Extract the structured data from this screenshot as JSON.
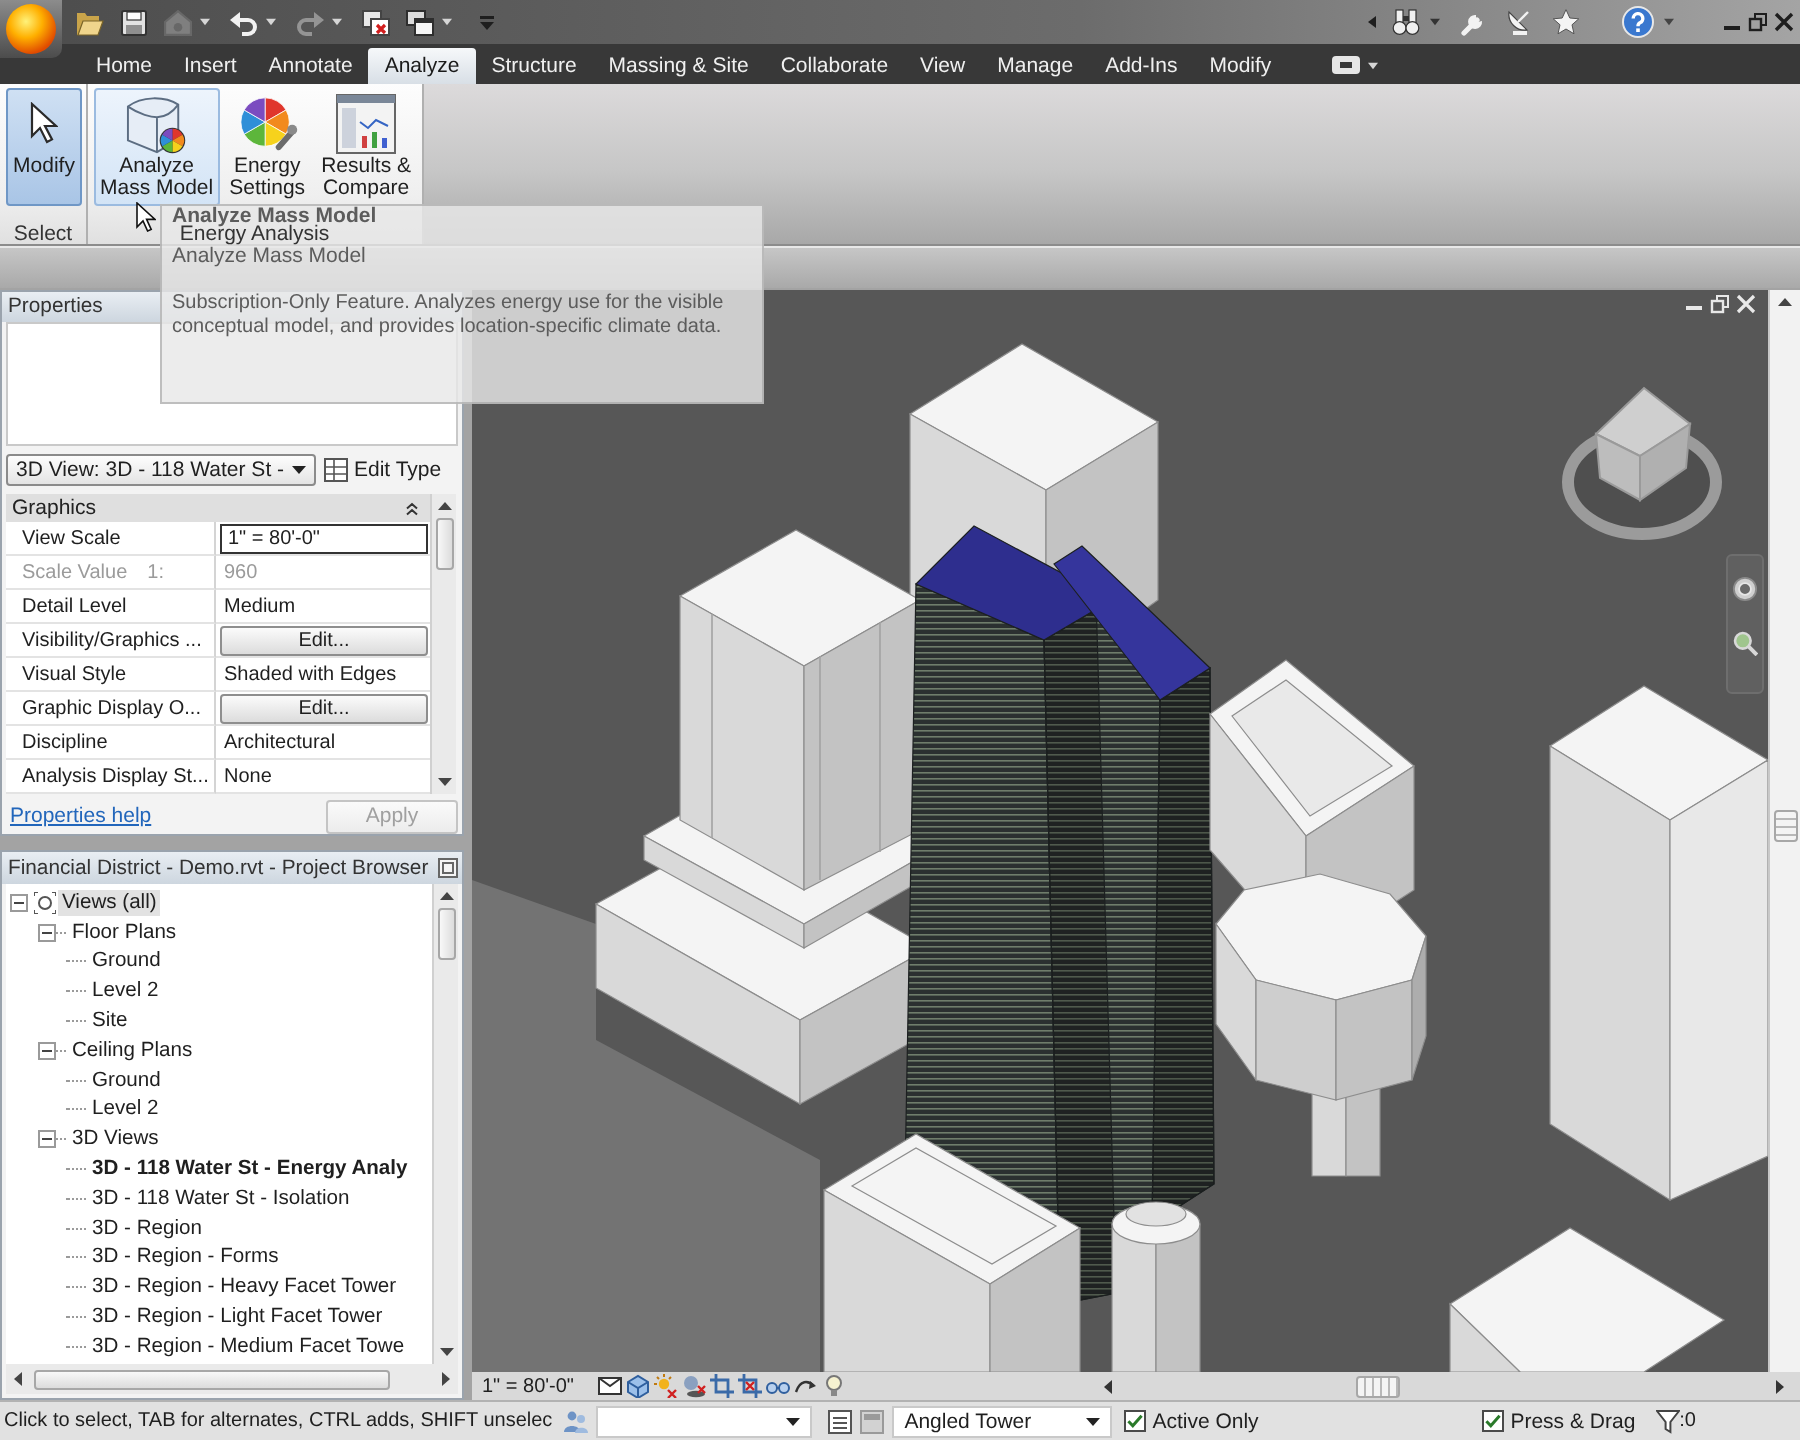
{
  "quick_access": [
    {
      "kind": "open",
      "disabled": false
    },
    {
      "kind": "save",
      "disabled": false
    },
    {
      "kind": "sync",
      "disabled": true
    },
    {
      "kind": "undo",
      "disabled": false
    },
    {
      "kind": "redo",
      "disabled": true
    },
    {
      "kind": "close_windows",
      "disabled": false
    },
    {
      "kind": "switch_windows",
      "disabled": false
    }
  ],
  "tabs": [
    {
      "label": "Home",
      "selected": false
    },
    {
      "label": "Insert",
      "selected": false
    },
    {
      "label": "Annotate",
      "selected": false
    },
    {
      "label": "Analyze",
      "selected": true
    },
    {
      "label": "Structure",
      "selected": false
    },
    {
      "label": "Massing & Site",
      "selected": false
    },
    {
      "label": "Collaborate",
      "selected": false
    },
    {
      "label": "View",
      "selected": false
    },
    {
      "label": "Manage",
      "selected": false
    },
    {
      "label": "Add-Ins",
      "selected": false
    },
    {
      "label": "Modify",
      "selected": false
    }
  ],
  "ribbon": {
    "panels": [
      {
        "label": "Select",
        "buttons": [
          {
            "kind": "modify",
            "lines": [
              "Modify"
            ],
            "selected": true,
            "hovered": false
          }
        ]
      },
      {
        "label": "Energy Analysis",
        "buttons": [
          {
            "kind": "analyze_mass",
            "lines": [
              "Analyze",
              "Mass Model"
            ],
            "selected": false,
            "hovered": true
          },
          {
            "kind": "energy_settings",
            "lines": [
              "Energy",
              "Settings"
            ],
            "selected": false,
            "hovered": false
          },
          {
            "kind": "results_compare",
            "lines": [
              "Results &",
              "Compare"
            ],
            "selected": false,
            "hovered": false
          }
        ]
      }
    ]
  },
  "tooltip": {
    "title": "Analyze Mass Model",
    "subtitle": "Analyze Mass Model",
    "description": "Subscription-Only Feature. Analyzes energy use for the visible conceptual model, and provides location-specific climate data."
  },
  "properties": {
    "title": "Properties",
    "type_selector": "3D View: 3D - 118 Water St -",
    "edit_type": "Edit Type",
    "group": {
      "label": "Graphics",
      "expanded": true
    },
    "rows": [
      {
        "name": "View Scale",
        "value": "1\" = 80'-0\"",
        "kind": "input",
        "disabled": false
      },
      {
        "name": "Scale Value",
        "unit": "1:",
        "value": "960",
        "kind": "text",
        "disabled": true
      },
      {
        "name": "Detail Level",
        "value": "Medium",
        "kind": "text",
        "disabled": false
      },
      {
        "name": "Visibility/Graphics ...",
        "value": "Edit...",
        "kind": "button",
        "disabled": false
      },
      {
        "name": "Visual Style",
        "value": "Shaded with Edges",
        "kind": "text",
        "disabled": false
      },
      {
        "name": "Graphic Display O...",
        "value": "Edit...",
        "kind": "button",
        "disabled": false
      },
      {
        "name": "Discipline",
        "value": "Architectural",
        "kind": "text",
        "disabled": false
      },
      {
        "name": "Analysis Display St...",
        "value": "None",
        "kind": "text",
        "disabled": false
      }
    ],
    "help_link": "Properties help",
    "apply": {
      "label": "Apply",
      "disabled": true
    }
  },
  "project_browser": {
    "title": "Financial District - Demo.rvt - Project Browser",
    "tree": [
      {
        "label": "Views (all)",
        "expanded": true,
        "selected": true,
        "children": [
          {
            "label": "Floor Plans",
            "expanded": true,
            "selected": false,
            "children": [
              {
                "label": "Ground",
                "selected": false,
                "active": false
              },
              {
                "label": "Level 2",
                "selected": false,
                "active": false
              },
              {
                "label": "Site",
                "selected": false,
                "active": false
              }
            ]
          },
          {
            "label": "Ceiling Plans",
            "expanded": true,
            "selected": false,
            "children": [
              {
                "label": "Ground",
                "selected": false,
                "active": false
              },
              {
                "label": "Level 2",
                "selected": false,
                "active": false
              }
            ]
          },
          {
            "label": "3D Views",
            "expanded": true,
            "selected": false,
            "children": [
              {
                "label": "3D - 118 Water St - Energy Analy",
                "selected": false,
                "active": true
              },
              {
                "label": "3D - 118 Water St - Isolation",
                "selected": false,
                "active": false
              },
              {
                "label": "3D - Region",
                "selected": false,
                "active": false
              },
              {
                "label": "3D - Region - Forms",
                "selected": false,
                "active": false
              },
              {
                "label": "3D - Region - Heavy Facet Tower",
                "selected": false,
                "active": false
              },
              {
                "label": "3D - Region - Light Facet Tower",
                "selected": false,
                "active": false
              },
              {
                "label": "3D - Region - Medium Facet Towe",
                "selected": false,
                "active": false
              }
            ]
          }
        ]
      }
    ]
  },
  "view_bar": {
    "scale": "1\" = 80'-0\""
  },
  "status_bar": {
    "hint": "Click to select, TAB for alternates, CTRL adds, SHIFT unselec",
    "design_option": "Angled Tower",
    "active_only": {
      "label": "Active Only",
      "checked": true
    },
    "press_and_drag": {
      "label": "Press & Drag",
      "checked": true
    },
    "filter_count": ":0"
  }
}
